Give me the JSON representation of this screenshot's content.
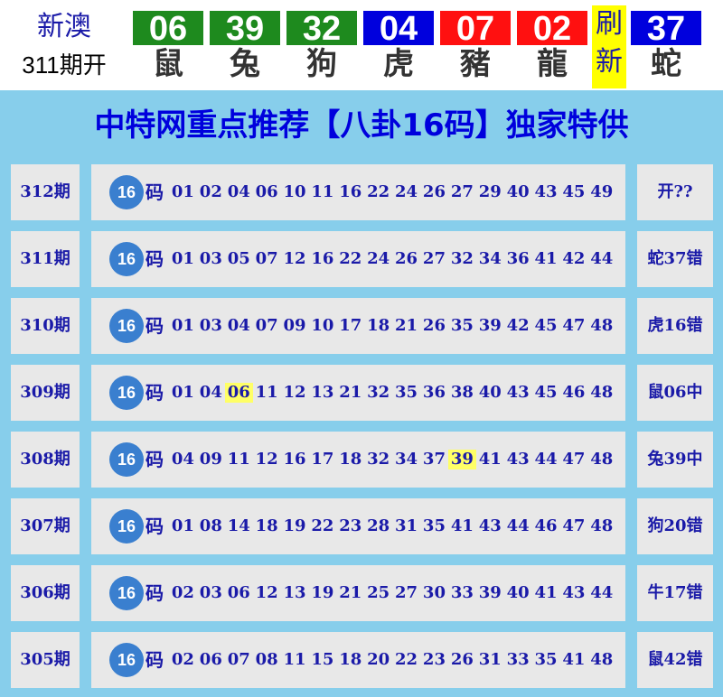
{
  "header": {
    "brand_line1": "新澳",
    "brand_line2": "311期开",
    "balls": [
      {
        "num": "06",
        "zodiac": "鼠",
        "color": "#1e8a1e"
      },
      {
        "num": "39",
        "zodiac": "兔",
        "color": "#1e8a1e"
      },
      {
        "num": "32",
        "zodiac": "狗",
        "color": "#1e8a1e"
      },
      {
        "num": "04",
        "zodiac": "虎",
        "color": "#0000dd"
      },
      {
        "num": "07",
        "zodiac": "豬",
        "color": "#ff1010"
      },
      {
        "num": "02",
        "zodiac": "龍",
        "color": "#ff1010"
      },
      {
        "num": "37",
        "zodiac": "蛇",
        "color": "#0000dd"
      }
    ],
    "refresh_line1": "刷",
    "refresh_line2": "新"
  },
  "banner": {
    "title": "中特网重点推荐【八卦16码】独家特供"
  },
  "table": {
    "badge": "16",
    "ma_label": "码",
    "rows": [
      {
        "period": "312期",
        "numbers": [
          "01",
          "02",
          "04",
          "06",
          "10",
          "11",
          "16",
          "22",
          "24",
          "26",
          "27",
          "29",
          "40",
          "43",
          "45",
          "49"
        ],
        "highlight": "",
        "result": "开??"
      },
      {
        "period": "311期",
        "numbers": [
          "01",
          "03",
          "05",
          "07",
          "12",
          "16",
          "22",
          "24",
          "26",
          "27",
          "32",
          "34",
          "36",
          "41",
          "42",
          "44"
        ],
        "highlight": "",
        "result": "蛇37错"
      },
      {
        "period": "310期",
        "numbers": [
          "01",
          "03",
          "04",
          "07",
          "09",
          "10",
          "17",
          "18",
          "21",
          "26",
          "35",
          "39",
          "42",
          "45",
          "47",
          "48"
        ],
        "highlight": "",
        "result": "虎16错"
      },
      {
        "period": "309期",
        "numbers": [
          "01",
          "04",
          "06",
          "11",
          "12",
          "13",
          "21",
          "32",
          "35",
          "36",
          "38",
          "40",
          "43",
          "45",
          "46",
          "48"
        ],
        "highlight": "06",
        "result": "鼠06中"
      },
      {
        "period": "308期",
        "numbers": [
          "04",
          "09",
          "11",
          "12",
          "16",
          "17",
          "18",
          "32",
          "34",
          "37",
          "39",
          "41",
          "43",
          "44",
          "47",
          "48"
        ],
        "highlight": "39",
        "result": "兔39中"
      },
      {
        "period": "307期",
        "numbers": [
          "01",
          "08",
          "14",
          "18",
          "19",
          "22",
          "23",
          "28",
          "31",
          "35",
          "41",
          "43",
          "44",
          "46",
          "47",
          "48"
        ],
        "highlight": "",
        "result": "狗20错"
      },
      {
        "period": "306期",
        "numbers": [
          "02",
          "03",
          "06",
          "12",
          "13",
          "19",
          "21",
          "25",
          "27",
          "30",
          "33",
          "39",
          "40",
          "41",
          "43",
          "44"
        ],
        "highlight": "",
        "result": "牛17错"
      },
      {
        "period": "305期",
        "numbers": [
          "02",
          "06",
          "07",
          "08",
          "11",
          "15",
          "18",
          "20",
          "22",
          "23",
          "26",
          "31",
          "33",
          "35",
          "41",
          "48"
        ],
        "highlight": "",
        "result": "鼠42错"
      }
    ]
  }
}
